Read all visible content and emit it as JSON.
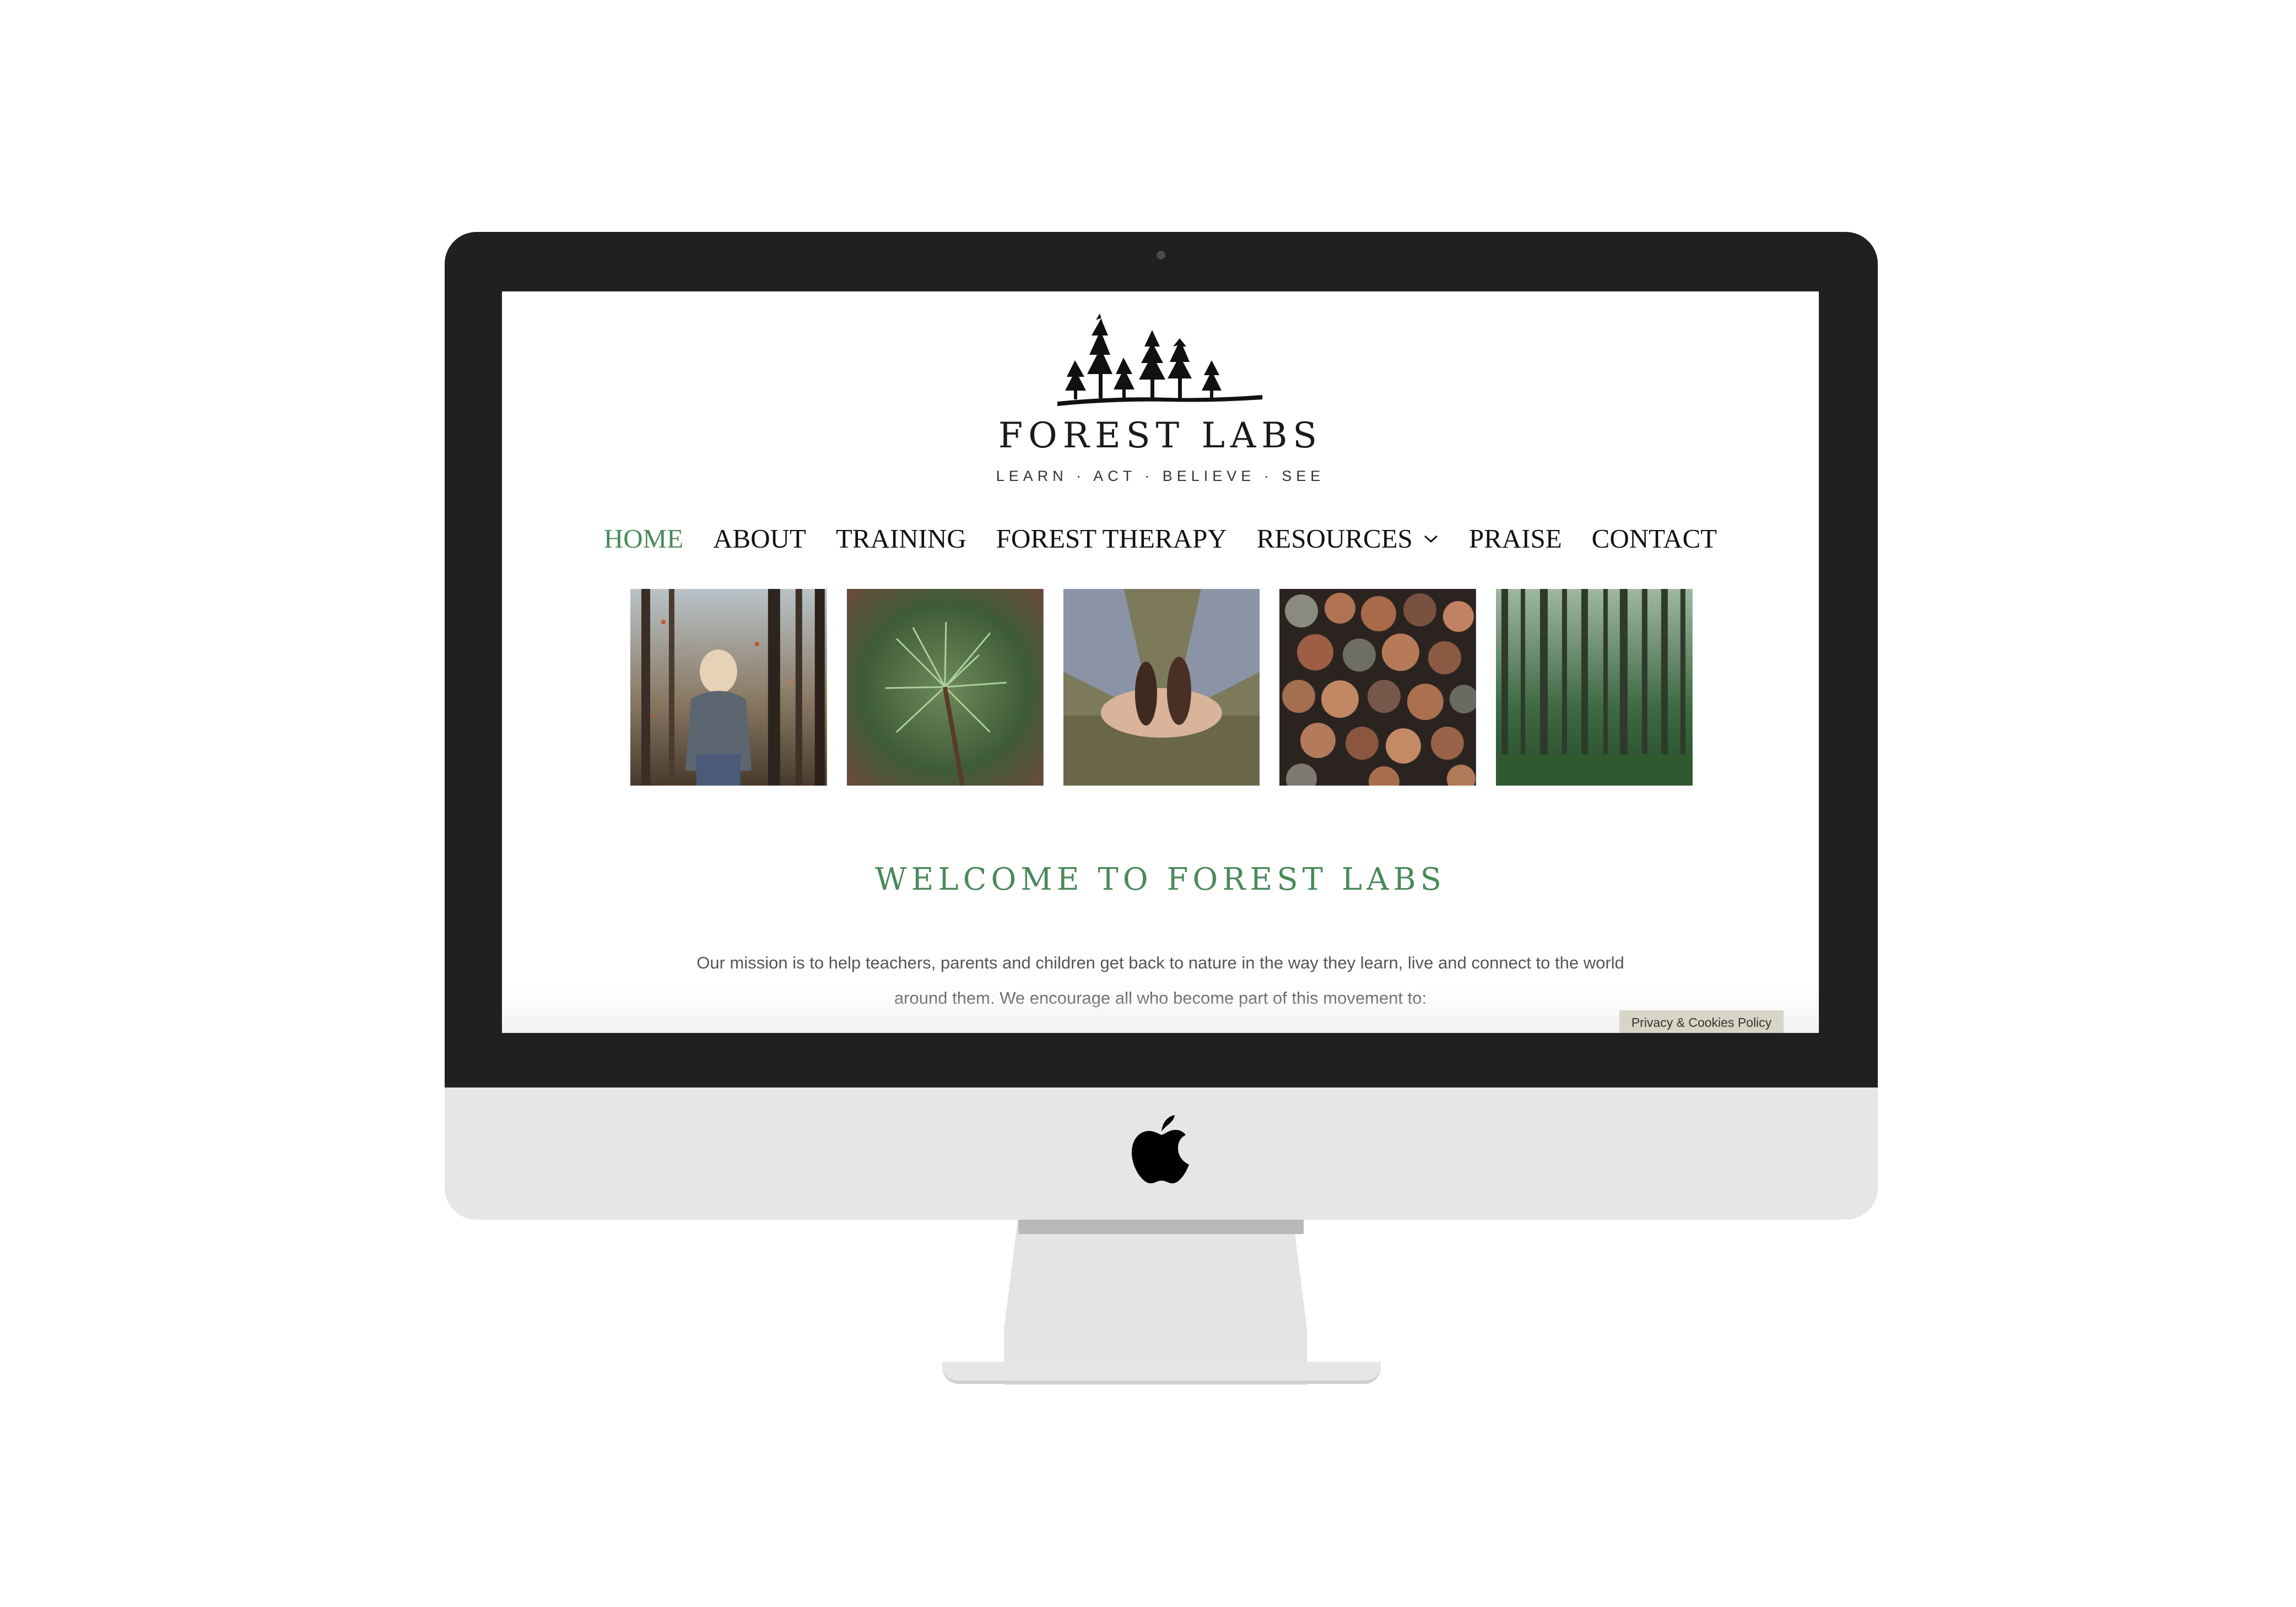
{
  "brand": {
    "name": "FOREST LABS",
    "tagline": "LEARN · ACT · BELIEVE · SEE"
  },
  "nav": {
    "items": [
      {
        "label": "HOME",
        "active": true
      },
      {
        "label": "ABOUT"
      },
      {
        "label": "TRAINING"
      },
      {
        "label": "FOREST THERAPY"
      },
      {
        "label": "RESOURCES",
        "has_dropdown": true
      },
      {
        "label": "PRAISE"
      },
      {
        "label": "CONTACT"
      }
    ]
  },
  "gallery": {
    "photos": [
      {
        "subject": "child in autumn forest"
      },
      {
        "subject": "pine needles close-up"
      },
      {
        "subject": "hands holding pine cones"
      },
      {
        "subject": "stacked cut logs"
      },
      {
        "subject": "tall forest trees"
      }
    ]
  },
  "main": {
    "welcome_heading": "WELCOME TO FOREST LABS",
    "mission_line1": "Our mission is to help teachers, parents and children get back to nature in the way they learn, live and connect to the world",
    "mission_line2": "around them. We encourage all who become part of this movement to:"
  },
  "footer": {
    "privacy_label": "Privacy & Cookies Policy"
  },
  "colors": {
    "accent_green": "#4a8a5a",
    "bezel": "#202020",
    "chin": "#e6e6e6",
    "privacy_bg": "#d7d5c6"
  },
  "icons": [
    "apple-logo-icon",
    "trees-logo-icon",
    "chevron-down-icon"
  ]
}
